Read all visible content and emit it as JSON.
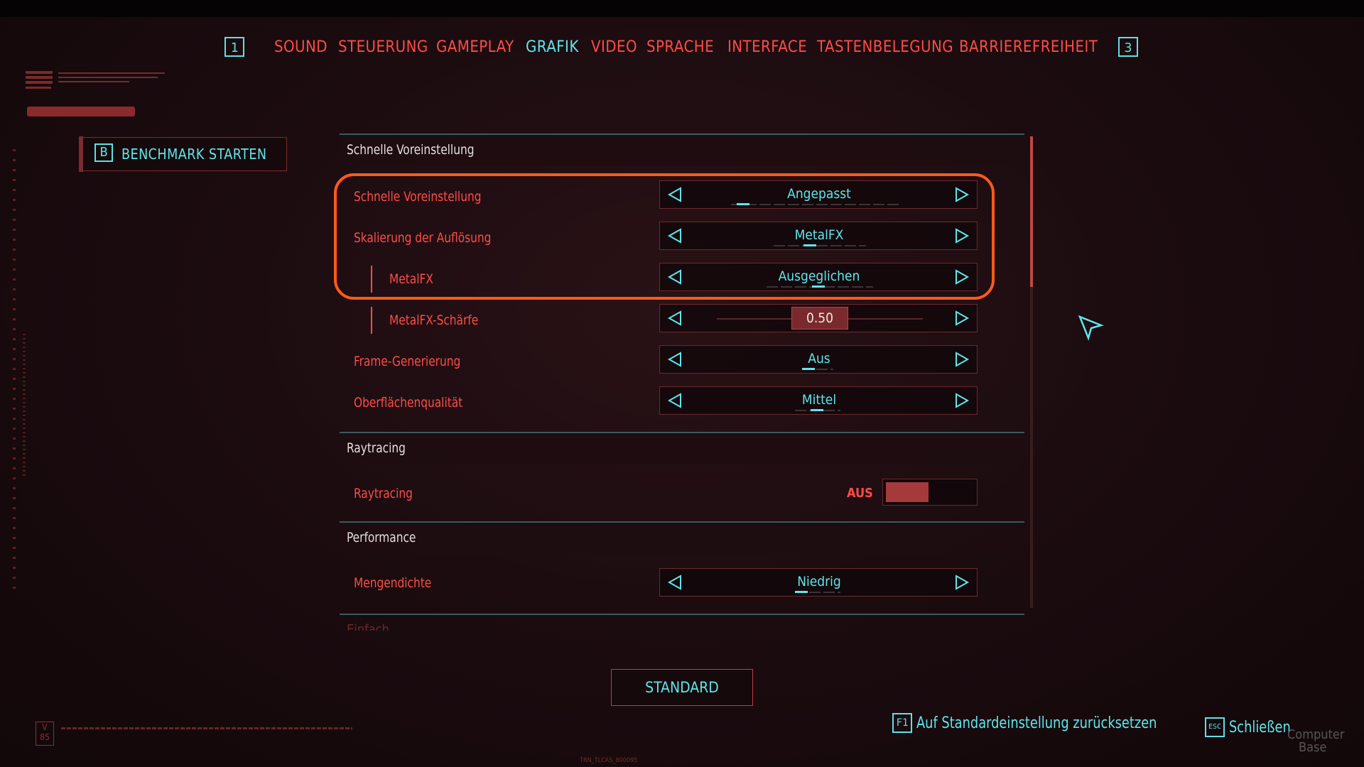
{
  "nav": {
    "left_key": "1",
    "right_key": "3",
    "tabs": [
      {
        "label": "SOUND"
      },
      {
        "label": "STEUERUNG"
      },
      {
        "label": "GAMEPLAY"
      },
      {
        "label": "GRAFIK"
      },
      {
        "label": "VIDEO"
      },
      {
        "label": "SPRACHE"
      },
      {
        "label": "INTERFACE"
      },
      {
        "label": "TASTENBELEGUNG"
      },
      {
        "label": "BARRIEREFREIHEIT"
      }
    ],
    "active_tab": "GRAFIK"
  },
  "benchmark": {
    "key": "B",
    "label": "BENCHMARK STARTEN"
  },
  "sections": {
    "quick": {
      "title": "Schnelle Voreinstellung"
    },
    "raytracing": {
      "title": "Raytracing"
    },
    "performance": {
      "title": "Performance"
    },
    "next": {
      "title": "Einfach"
    }
  },
  "settings": {
    "preset": {
      "label": "Schnelle Voreinstellung",
      "value": "Angepasst"
    },
    "scaling": {
      "label": "Skalierung der Auflösung",
      "value": "MetalFX"
    },
    "metalfx": {
      "label": "MetalFX",
      "value": "Ausgeglichen"
    },
    "sharpness": {
      "label": "MetalFX-Schärfe",
      "value": "0.50",
      "fraction": 0.5
    },
    "framegen": {
      "label": "Frame-Generierung",
      "value": "Aus"
    },
    "surface": {
      "label": "Oberflächenqualität",
      "value": "Mittel"
    },
    "raytracing": {
      "label": "Raytracing",
      "state": "AUS"
    },
    "crowd": {
      "label": "Mengendichte",
      "value": "Niedrig"
    }
  },
  "footer": {
    "standard_label": "STANDARD",
    "reset_key": "F1",
    "reset_label": "Auf Standardeinstellung zurücksetzen",
    "close_key": "ESC",
    "close_label": "Schließen",
    "version": "V 85",
    "trn_code": "TRN_TLCAS_800095"
  },
  "watermark": {
    "line1": "Computer",
    "line2": "Base"
  },
  "colors": {
    "accent_cyan": "#5fe6ea",
    "accent_red": "#ff4c46",
    "highlight_orange": "#ff5a1a"
  }
}
